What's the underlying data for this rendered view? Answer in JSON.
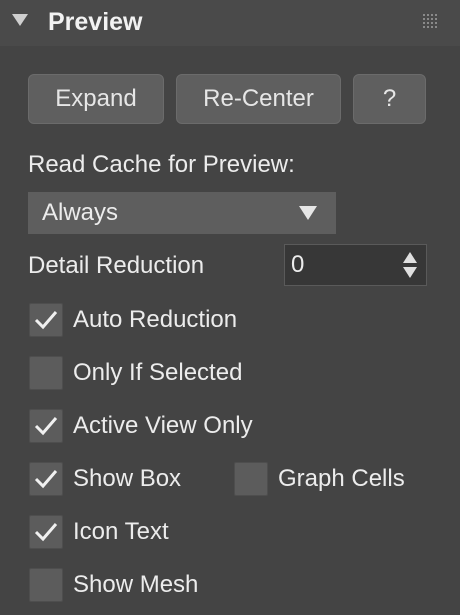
{
  "panel": {
    "title": "Preview"
  },
  "buttons": {
    "expand": "Expand",
    "recenter": "Re-Center",
    "help": "?"
  },
  "read_cache": {
    "label": "Read Cache for Preview:",
    "selected": "Always"
  },
  "detail_reduction": {
    "label": "Detail Reduction",
    "value": "0"
  },
  "options": {
    "auto_reduction": {
      "label": "Auto Reduction",
      "checked": true
    },
    "only_if_selected": {
      "label": "Only If Selected",
      "checked": false
    },
    "active_view_only": {
      "label": "Active View Only",
      "checked": true
    },
    "show_box": {
      "label": "Show Box",
      "checked": true
    },
    "graph_cells": {
      "label": "Graph Cells",
      "checked": false
    },
    "icon_text": {
      "label": "Icon Text",
      "checked": true
    },
    "show_mesh": {
      "label": "Show Mesh",
      "checked": false
    }
  },
  "colors": {
    "background": "#444444",
    "button": "#5f5f5f",
    "checkbox": "#5c5c5c",
    "text": "#ececec"
  }
}
